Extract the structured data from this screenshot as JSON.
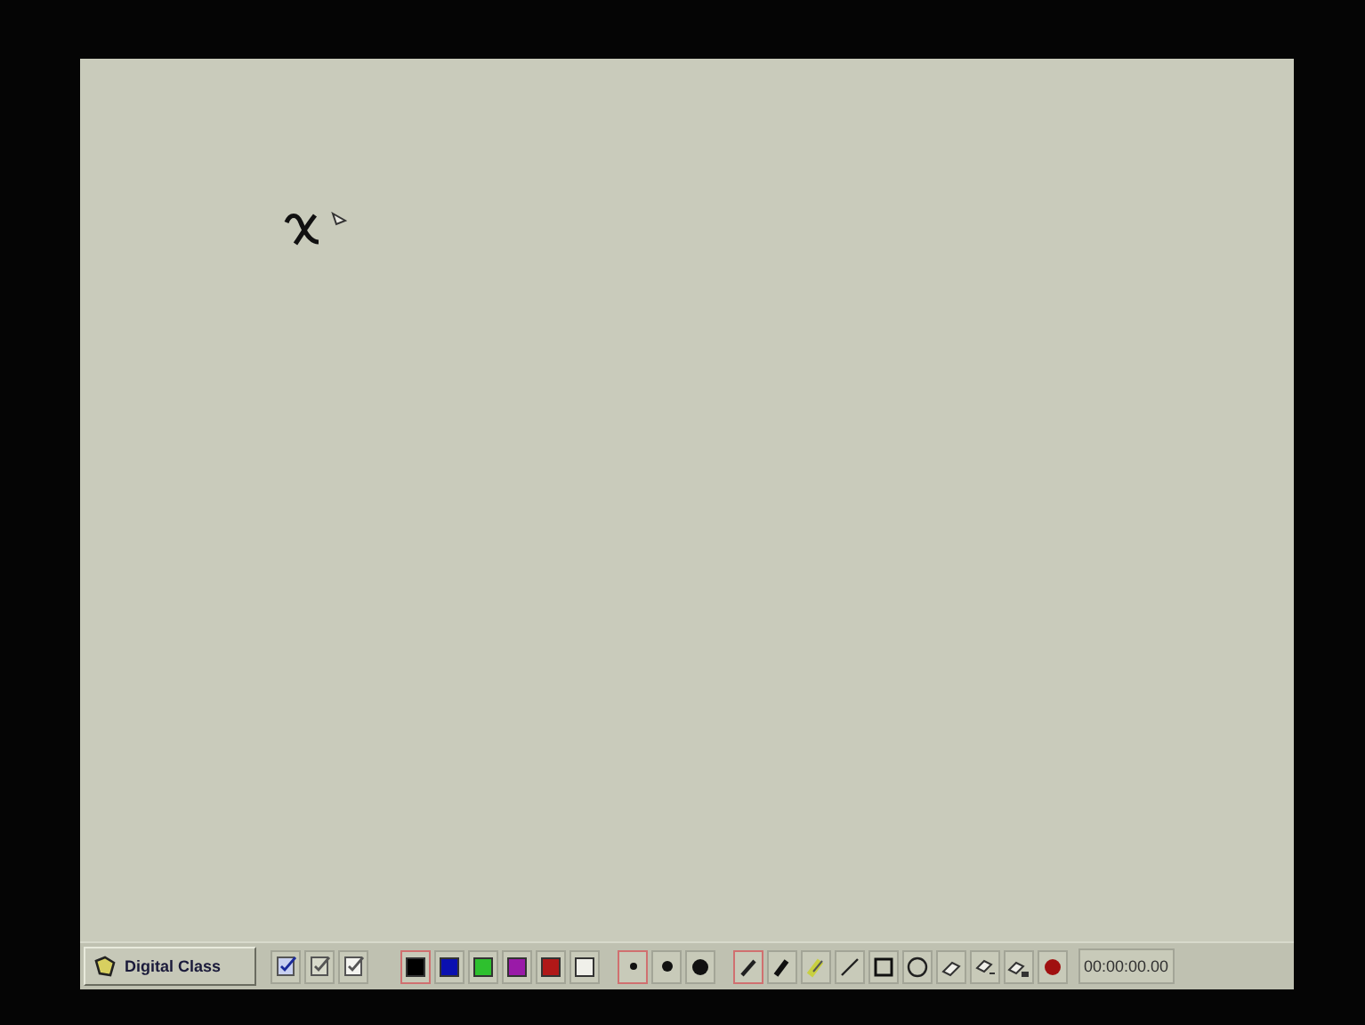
{
  "start_button": {
    "label": "Digital Class"
  },
  "page_tools": [
    {
      "kind": "page-check"
    },
    {
      "kind": "page-edit"
    },
    {
      "kind": "page-blank"
    }
  ],
  "colors": [
    {
      "color": "#000000",
      "selected": true
    },
    {
      "color": "#0a10b0",
      "selected": false
    },
    {
      "color": "#2ec02e",
      "selected": false
    },
    {
      "color": "#9a1aa8",
      "selected": false
    },
    {
      "color": "#b01818",
      "selected": false
    },
    {
      "color": "#f0f0ea",
      "selected": false
    }
  ],
  "pen_sizes": [
    {
      "kind": "small",
      "selected": true
    },
    {
      "kind": "medium",
      "selected": false
    },
    {
      "kind": "large",
      "selected": false
    }
  ],
  "tools": [
    {
      "kind": "pen",
      "selected": true
    },
    {
      "kind": "marker",
      "selected": false
    },
    {
      "kind": "highlighter",
      "selected": false
    },
    {
      "kind": "line",
      "selected": false
    },
    {
      "kind": "rectangle",
      "selected": false
    },
    {
      "kind": "ellipse",
      "selected": false
    },
    {
      "kind": "eraser",
      "selected": false
    },
    {
      "kind": "area-eraser",
      "selected": false
    },
    {
      "kind": "clear",
      "selected": false
    },
    {
      "kind": "record",
      "selected": false
    }
  ],
  "timer": "00:00:00.00"
}
